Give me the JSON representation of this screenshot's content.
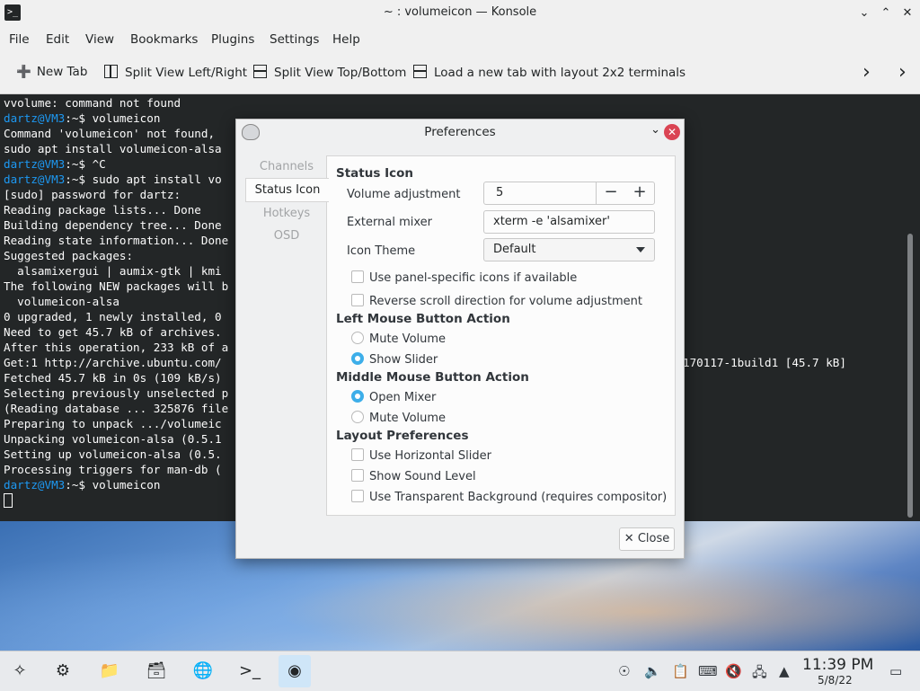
{
  "window": {
    "title": "~ : volumeicon — Konsole"
  },
  "menu": [
    "File",
    "Edit",
    "View",
    "Bookmarks",
    "Plugins",
    "Settings",
    "Help"
  ],
  "toolbar": {
    "new_tab": "New Tab",
    "split_lr": "Split View Left/Right",
    "split_tb": "Split View Top/Bottom",
    "load_layout": "Load a new tab with layout 2x2 terminals"
  },
  "terminal": {
    "lines": [
      "vvolume: command not found",
      "volumeicon",
      "Command 'volumeicon' not found,",
      "sudo apt install volumeicon-alsa",
      "^C",
      "sudo apt install vo",
      "[sudo] password for dartz:",
      "Reading package lists... Done",
      "Building dependency tree... Done",
      "Reading state information... Done",
      "Suggested packages:",
      "  alsamixergui | aumix-gtk | kmi",
      "The following NEW packages will b",
      "  volumeicon-alsa",
      "0 upgraded, 1 newly installed, 0",
      "Need to get 45.7 kB of archives.",
      "After this operation, 233 kB of a",
      "Get:1 http://archive.ubuntu.com/",
      "Fetched 45.7 kB in 0s (109 kB/s)",
      "Selecting previously unselected p",
      "(Reading database ... 325876 file",
      "Preparing to unpack .../volumeic",
      "Unpacking volumeicon-alsa (0.5.1",
      "Setting up volumeicon-alsa (0.5.",
      "Processing triggers for man-db (",
      "volumeicon"
    ],
    "prompt": "dartz@VM3",
    "prompt_suffix": ":~$ ",
    "get_tail": "170117-1build1 [45.7 kB]"
  },
  "dialog": {
    "title": "Preferences",
    "tabs": [
      "Channels",
      "Status Icon",
      "Hotkeys",
      "OSD"
    ],
    "status_icon_heading": "Status Icon",
    "volume_adjustment_label": "Volume adjustment",
    "volume_adjustment_value": "5",
    "external_mixer_label": "External mixer",
    "external_mixer_value": "xterm -e 'alsamixer'",
    "icon_theme_label": "Icon Theme",
    "icon_theme_value": "Default",
    "cb_panel_icons": "Use panel-specific icons if available",
    "cb_reverse_scroll": "Reverse scroll direction for volume adjustment",
    "left_heading": "Left Mouse Button Action",
    "left_mute": "Mute Volume",
    "left_slider": "Show Slider",
    "middle_heading": "Middle Mouse Button Action",
    "middle_open": "Open Mixer",
    "middle_mute": "Mute Volume",
    "layout_heading": "Layout Preferences",
    "cb_horizontal": "Use Horizontal Slider",
    "cb_sound_level": "Show Sound Level",
    "cb_transparent": "Use Transparent Background (requires compositor)",
    "close_label": "Close"
  },
  "taskbar": {
    "time": "11:39 PM",
    "date": "5/8/22"
  }
}
